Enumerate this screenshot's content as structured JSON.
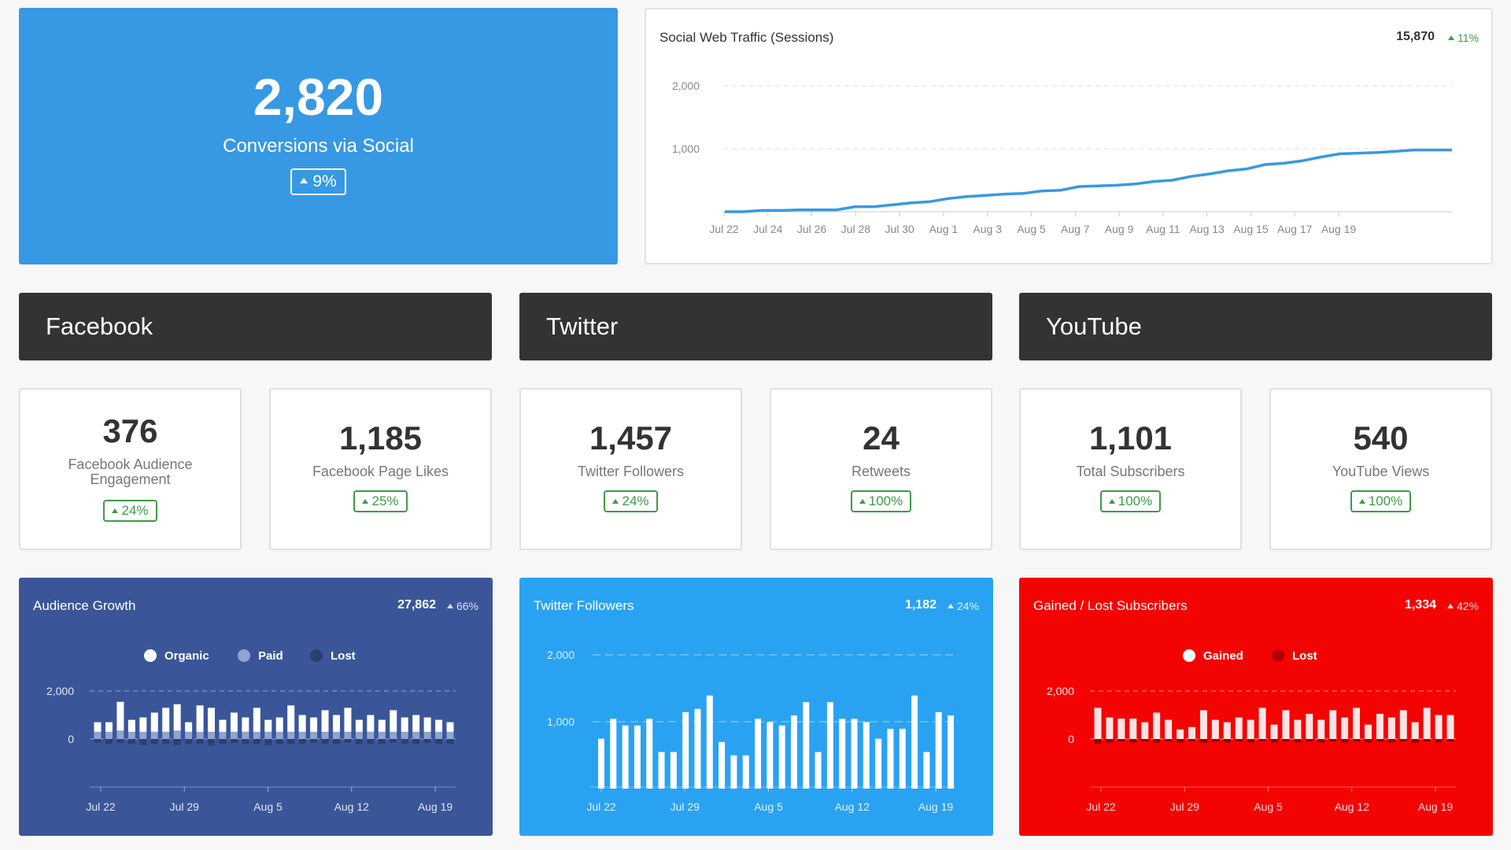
{
  "hero": {
    "value": "2,820",
    "label": "Conversions via Social",
    "change": "9%"
  },
  "traffic": {
    "title": "Social Web Traffic (Sessions)",
    "total": "15,870",
    "change": "11%",
    "chart_data": {
      "type": "line",
      "x_labels": [
        "Jul 22",
        "Jul 24",
        "Jul 26",
        "Jul 28",
        "Jul 30",
        "Aug 1",
        "Aug 3",
        "Aug 5",
        "Aug 7",
        "Aug 9",
        "Aug 11",
        "Aug 13",
        "Aug 15",
        "Aug 17",
        "Aug 19"
      ],
      "y_ticks": [
        "2,000",
        "1,000"
      ],
      "ylim": [
        -100,
        2000
      ],
      "values": [
        0,
        0,
        20,
        20,
        30,
        30,
        30,
        80,
        80,
        110,
        140,
        160,
        210,
        240,
        260,
        280,
        290,
        330,
        340,
        400,
        410,
        420,
        440,
        480,
        500,
        560,
        600,
        650,
        680,
        750,
        770,
        810,
        870,
        920,
        930,
        940,
        960,
        980,
        980,
        980
      ]
    }
  },
  "sections": [
    "Facebook",
    "Twitter",
    "YouTube"
  ],
  "kpis": [
    {
      "value": "376",
      "label": "Facebook Audience Engagement",
      "change": "24%"
    },
    {
      "value": "1,185",
      "label": "Facebook Page Likes",
      "change": "25%"
    },
    {
      "value": "1,457",
      "label": "Twitter Followers",
      "change": "24%"
    },
    {
      "value": "24",
      "label": "Retweets",
      "change": "100%"
    },
    {
      "value": "1,101",
      "label": "Total Subscribers",
      "change": "100%"
    },
    {
      "value": "540",
      "label": "YouTube Views",
      "change": "100%"
    }
  ],
  "audience": {
    "title": "Audience Growth",
    "total": "27,862",
    "change": "66%",
    "bg": "#3a5699",
    "legend": [
      "Organic",
      "Paid",
      "Lost"
    ],
    "chart_data": {
      "type": "bar",
      "x_labels": [
        "Jul 22",
        "Jul 29",
        "Aug 5",
        "Aug 12",
        "Aug 19"
      ],
      "y_ticks": [
        "2,000",
        "0"
      ],
      "ylim": [
        -500,
        2500
      ],
      "organic": [
        400,
        400,
        1200,
        500,
        600,
        800,
        1000,
        1100,
        400,
        1100,
        1000,
        500,
        800,
        600,
        1000,
        500,
        600,
        1100,
        700,
        600,
        900,
        700,
        1000,
        500,
        700,
        500,
        900,
        600,
        700,
        600,
        500,
        400
      ],
      "paid": [
        300,
        300,
        350,
        300,
        300,
        300,
        300,
        350,
        300,
        300,
        300,
        300,
        300,
        300,
        300,
        300,
        300,
        300,
        300,
        300,
        300,
        300,
        300,
        300,
        300,
        300,
        300,
        300,
        300,
        300,
        300,
        300
      ],
      "lost": [
        -150,
        -200,
        -150,
        -200,
        -250,
        -200,
        -200,
        -250,
        -200,
        -200,
        -250,
        -200,
        -150,
        -200,
        -200,
        -250,
        -200,
        -200,
        -200,
        -150,
        -200,
        -200,
        -150,
        -200,
        -200,
        -200,
        -150,
        -200,
        -200,
        -150,
        -200,
        -200
      ]
    }
  },
  "twitterChart": {
    "title": "Twitter Followers",
    "total": "1,182",
    "change": "24%",
    "bg": "#2aa2f2",
    "chart_data": {
      "type": "bar",
      "x_labels": [
        "Jul 22",
        "Jul 29",
        "Aug 5",
        "Aug 12",
        "Aug 19"
      ],
      "y_ticks": [
        "2,000",
        "1,000"
      ],
      "ylim": [
        0,
        2000
      ],
      "values": [
        750,
        1050,
        950,
        950,
        1050,
        550,
        550,
        1150,
        1200,
        1400,
        700,
        500,
        500,
        1050,
        1000,
        950,
        1100,
        1300,
        550,
        1300,
        1050,
        1050,
        1000,
        750,
        900,
        900,
        1400,
        550,
        1150,
        1100
      ]
    }
  },
  "youtubeChart": {
    "title": "Gained / Lost Subscribers",
    "total": "1,334",
    "change": "42%",
    "bg": "#f40303",
    "legend": [
      "Gained",
      "Lost"
    ],
    "chart_data": {
      "type": "bar",
      "x_labels": [
        "Jul 22",
        "Jul 29",
        "Aug 5",
        "Aug 12",
        "Aug 19"
      ],
      "y_ticks": [
        "2,000",
        "0"
      ],
      "ylim": [
        -500,
        2500
      ],
      "gained": [
        1300,
        900,
        850,
        850,
        700,
        1100,
        800,
        400,
        500,
        1200,
        800,
        700,
        900,
        800,
        1300,
        600,
        1200,
        800,
        1050,
        800,
        1200,
        900,
        1300,
        600,
        1050,
        900,
        1200,
        700,
        1300,
        1000,
        1000
      ],
      "lost": [
        -200,
        -150,
        -100,
        -150,
        -100,
        -150,
        -100,
        -150,
        -100,
        -150,
        -100,
        -150,
        -100,
        -150,
        -100,
        -150,
        -100,
        -150,
        -100,
        -150,
        -100,
        -150,
        -100,
        -150,
        -100,
        -150,
        -100,
        -150,
        -100,
        -150,
        -100
      ]
    }
  }
}
